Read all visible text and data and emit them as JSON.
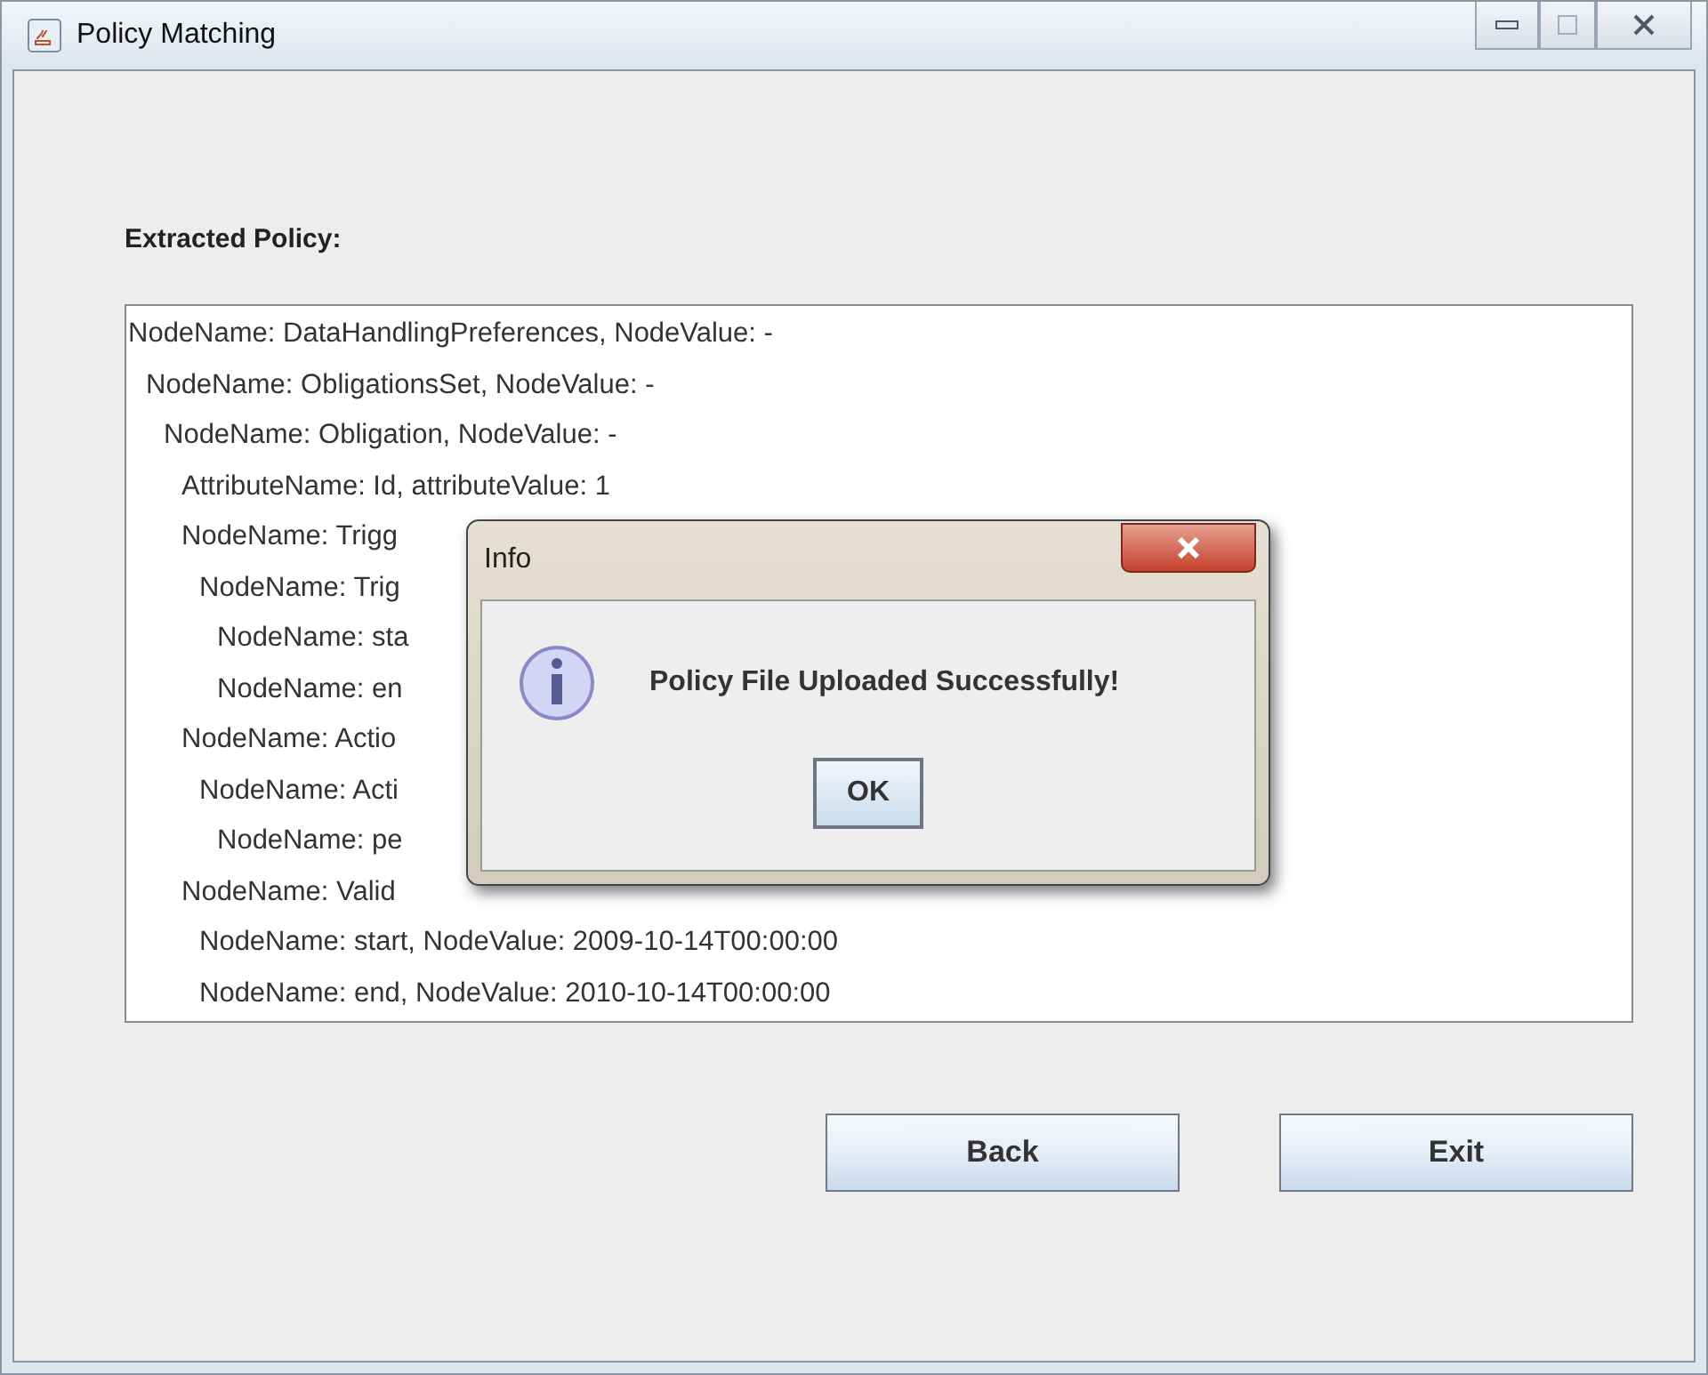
{
  "window": {
    "title": "Policy Matching"
  },
  "label": "Extracted Policy:",
  "tree": [
    {
      "text": "NodeName: DataHandlingPreferences, NodeValue: -",
      "children": [
        {
          "text": "NodeName: ObligationsSet, NodeValue: -",
          "children": [
            {
              "text": "NodeName: Obligation, NodeValue: -",
              "children": [
                {
                  "text": "AttributeName: Id, attributeValue: 1"
                },
                {
                  "text": "NodeName: Trigg",
                  "children": [
                    {
                      "text": "NodeName: Trig",
                      "children": [
                        {
                          "text": "NodeName: sta"
                        },
                        {
                          "text": "NodeName: en"
                        }
                      ]
                    }
                  ]
                },
                {
                  "text": "NodeName: Actio",
                  "children": [
                    {
                      "text": "NodeName: Acti",
                      "children": [
                        {
                          "text": "NodeName: pe"
                        }
                      ]
                    }
                  ]
                },
                {
                  "text": "NodeName: Valid",
                  "children": [
                    {
                      "text": "NodeName: start, NodeValue:  2009-10-14T00:00:00"
                    },
                    {
                      "text": "NodeName: end, NodeValue:  2010-10-14T00:00:00"
                    }
                  ]
                }
              ]
            }
          ]
        }
      ]
    }
  ],
  "buttons": [
    "Back",
    "Exit"
  ],
  "dialog": {
    "title": "Info",
    "message": "Policy File Uploaded Successfully!",
    "button": "OK"
  }
}
